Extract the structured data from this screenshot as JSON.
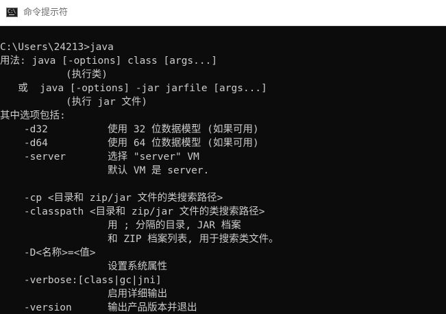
{
  "window": {
    "title": "命令提示符",
    "icon": "cmd-console-icon",
    "icon_glyph": "C:\\"
  },
  "colors": {
    "console_bg": "#0c0c0c",
    "console_text": "#cccccc",
    "title_text": "#6d6d6d"
  },
  "console": {
    "lines": [
      "C:\\Users\\24213>java",
      "用法: java [-options] class [args...]",
      "           (执行类)",
      "   或  java [-options] -jar jarfile [args...]",
      "           (执行 jar 文件)",
      "其中选项包括:",
      "    -d32          使用 32 位数据模型 (如果可用)",
      "    -d64          使用 64 位数据模型 (如果可用)",
      "    -server       选择 \"server\" VM",
      "                  默认 VM 是 server.",
      "",
      "    -cp <目录和 zip/jar 文件的类搜索路径>",
      "    -classpath <目录和 zip/jar 文件的类搜索路径>",
      "                  用 ; 分隔的目录, JAR 档案",
      "                  和 ZIP 档案列表, 用于搜索类文件。",
      "    -D<名称>=<值>",
      "                  设置系统属性",
      "    -verbose:[class|gc|jni]",
      "                  启用详细输出",
      "    -version      输出产品版本并退出"
    ]
  }
}
